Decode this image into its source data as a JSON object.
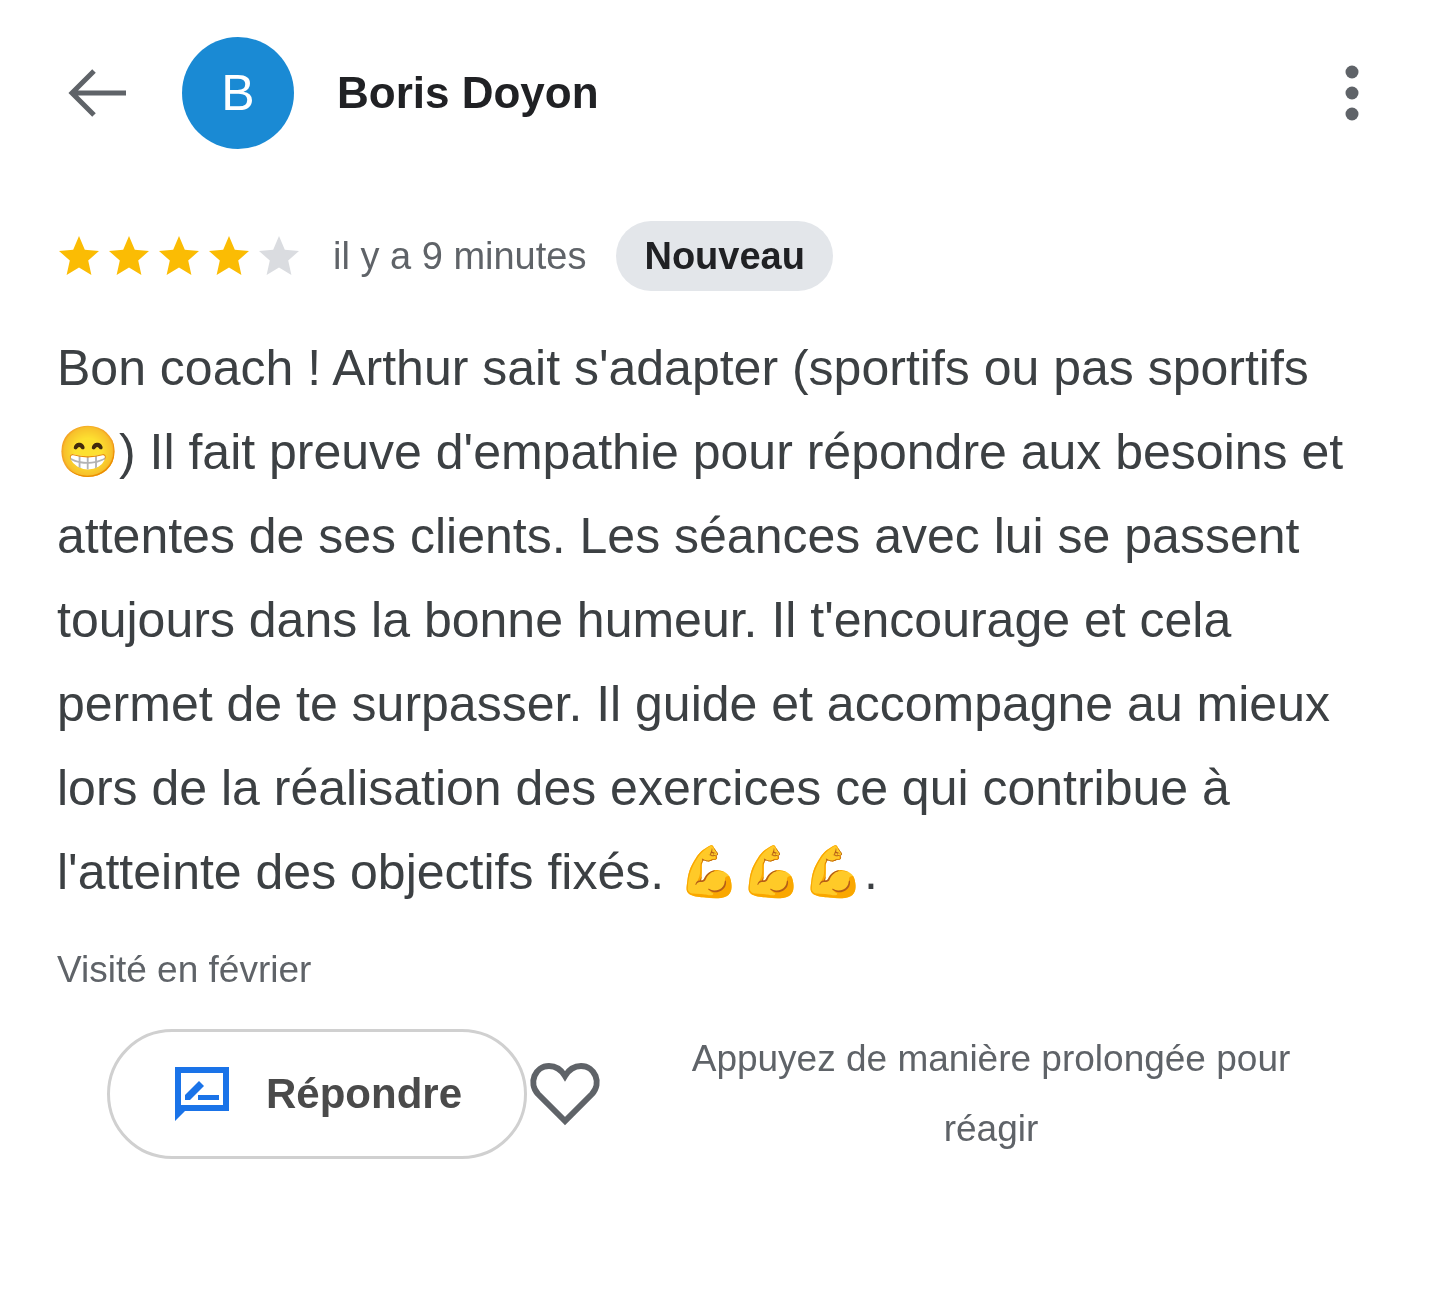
{
  "header": {
    "avatar_letter": "B",
    "name": "Boris Doyon"
  },
  "review": {
    "stars": 4,
    "time": "il y a 9 minutes",
    "badge": "Nouveau",
    "text": "Bon coach ! Arthur sait s'adapter (sportifs ou pas sportifs 😁) Il fait preuve d'empathie pour répondre aux besoins et attentes de ses clients. Les séances avec lui se passent toujours dans la bonne humeur. Il t'encourage et cela permet de te surpasser. Il guide et accompagne au mieux lors de la réalisation des exercices ce qui contribue à l'atteinte des objectifs fixés. 💪💪💪.",
    "visited": "Visité en février"
  },
  "actions": {
    "reply_button": "Répondre",
    "hint": "Appuyez de manière prolongée pour réagir"
  }
}
